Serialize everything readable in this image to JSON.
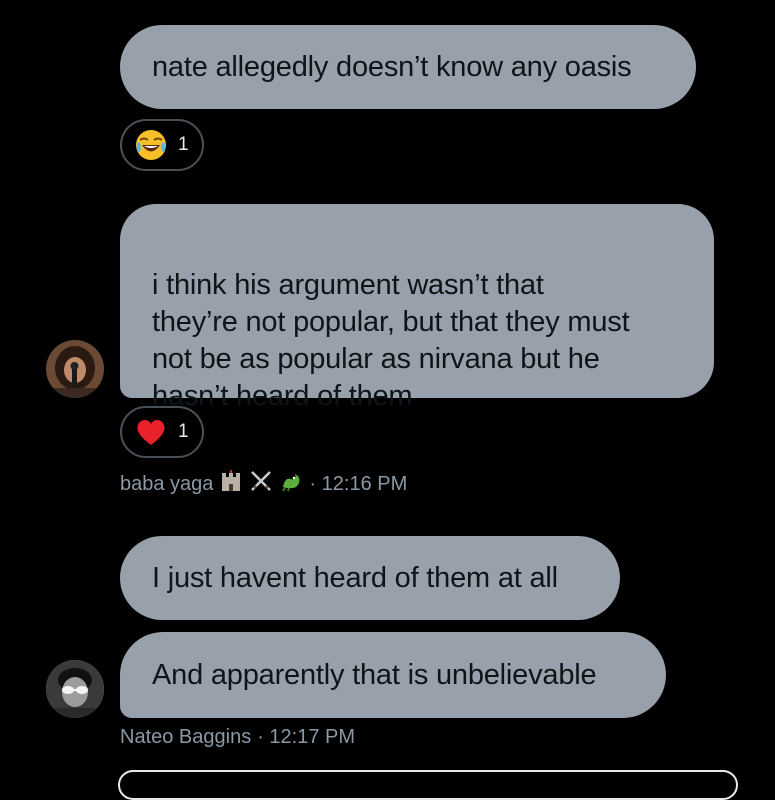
{
  "messages": [
    {
      "text": "nate allegedly doesn’t know any oasis",
      "reaction": {
        "emoji": "face-with-tears-of-joy",
        "count": "1"
      }
    },
    {
      "text": "i think his argument wasn’t that\nthey’re not popular, but that they must\nnot be as popular as nirvana but he\nhasn’t heard of them",
      "reaction": {
        "emoji": "red-heart",
        "count": "1"
      }
    },
    {
      "text": "I just havent heard of them at all"
    },
    {
      "text": "And apparently that is unbelievable"
    }
  ],
  "senders": {
    "first": {
      "name": "baba yaga",
      "emoji_tags": [
        "castle-icon",
        "crossed-swords-icon",
        "dragon-icon"
      ],
      "time": "· 12:16 PM"
    },
    "second": {
      "name": "Nateo Baggins",
      "time": "· 12:17 PM"
    }
  },
  "colors": {
    "background": "#000000",
    "bubble": "#98a1ab",
    "bubble_text": "#0f1419",
    "meta_text": "#8b98a5",
    "reaction_border": "#4a5058"
  }
}
